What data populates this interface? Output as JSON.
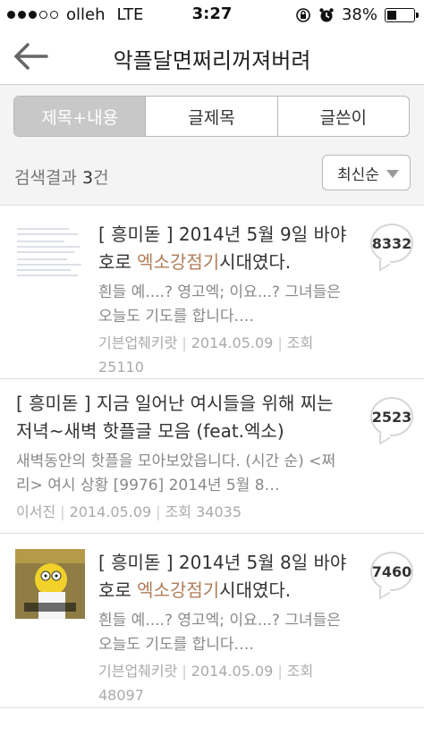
{
  "status": {
    "carrier": "olleh",
    "network": "LTE",
    "time": "3:27",
    "battery": "38%",
    "battery_level": 0.38
  },
  "header": {
    "title": "악플달면쩌리꺼져버려"
  },
  "tabs": [
    {
      "label": "제목+내용",
      "active": true
    },
    {
      "label": "글제목",
      "active": false
    },
    {
      "label": "글쓴이",
      "active": false
    }
  ],
  "results": {
    "label": "검색결과",
    "count": "3",
    "unit": "건",
    "sort_label": "최신순"
  },
  "posts": [
    {
      "title_pre": "[ 흥미돋 ] 2014년 5월 9일 바야호로 ",
      "title_hl": "엑소강점기",
      "title_post": "시대였다.",
      "excerpt": "흰들 예....? 영고엑; 이요...? 그녀들은 오늘도 기도를 합니다.…",
      "author": "기븐업췌키랏",
      "date": "2014.05.09",
      "views_label": "조회",
      "views": "25110",
      "comments": "8332"
    },
    {
      "title_pre": "[ 흥미돋 ] 지금 일어난 여시들을 위해 찌는 저녁~새벽 핫플글 모음 (feat.엑소)",
      "title_hl": "",
      "title_post": "",
      "excerpt": "새벽동안의 핫플을 모아보았읍니다. (시간 순) <쩌리> 여시 상황 [9976] 2014년 5월 8…",
      "author": "이서진",
      "date": "2014.05.09",
      "views_label": "조회",
      "views": "34035",
      "comments": "2523"
    },
    {
      "title_pre": "[ 흥미돋 ] 2014년 5월 8일 바야호로 ",
      "title_hl": "엑소강점기",
      "title_post": "시대였다.",
      "excerpt": "흰들 예....? 영고엑; 이요...? 그녀들은 오늘도 기도를 합니다.…",
      "author": "기븐업췌키랏",
      "date": "2014.05.09",
      "views_label": "조회",
      "views": "48097",
      "comments": "7460"
    }
  ],
  "colors": {
    "highlight": "#b07c57",
    "active_tab": "#c8c8c8"
  }
}
